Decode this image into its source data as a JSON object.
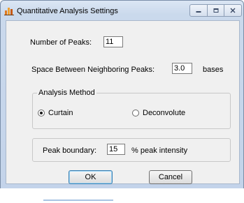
{
  "window": {
    "title": "Quantitative Analysis Settings",
    "icon": "chart-app-icon",
    "controls": [
      "minimize-icon",
      "maximize-icon",
      "close-icon"
    ]
  },
  "peaks": {
    "number_label": "Number of Peaks:",
    "number_value": "11",
    "spacing_label": "Space Between Neighboring Peaks:",
    "spacing_value": "3.0",
    "spacing_unit": "bases"
  },
  "analysis_method": {
    "group_title": "Analysis Method",
    "options": [
      {
        "label": "Curtain",
        "selected": true
      },
      {
        "label": "Deconvolute",
        "selected": false
      }
    ]
  },
  "boundary": {
    "label": "Peak boundary:",
    "value": "15",
    "unit": "% peak intensity"
  },
  "buttons": {
    "ok": "OK",
    "cancel": "Cancel"
  }
}
